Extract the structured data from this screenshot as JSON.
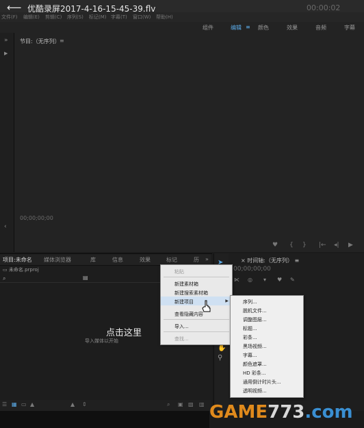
{
  "player": {
    "title": "优酷录屏2017-4-16-15-45-39.flv",
    "time": "00:00:02"
  },
  "menubar": [
    "文件(F)",
    "编辑(E)",
    "剪辑(C)",
    "序列(S)",
    "标记(M)",
    "字幕(T)",
    "窗口(W)",
    "帮助(H)"
  ],
  "workspace": {
    "tabs": [
      "组件",
      "编辑",
      "颜色",
      "效果",
      "音频",
      "字幕"
    ],
    "active_index": 1,
    "menu_glyph": "≡"
  },
  "program": {
    "title": "节目:（无序列）",
    "menu_glyph": "≡",
    "timecode": "00;00;00;00"
  },
  "project": {
    "tabs": [
      "项目:未命名",
      "媒体浏览器",
      "库",
      "信息",
      "效果",
      "标记",
      "历",
      "»"
    ],
    "file": "未命名.prproj",
    "empty_title": "点击这里",
    "empty_hint": "导入媒体以开始"
  },
  "timeline": {
    "title": "时间轴:（无序列）",
    "menu_glyph": "≡",
    "timecode": "00;00;00;00"
  },
  "context_menu": {
    "items": [
      "粘贴",
      "新建素材箱",
      "新建搜索素材箱",
      "新建项目",
      "查看隐藏内容",
      "导入...",
      "查找..."
    ]
  },
  "submenu": {
    "items": [
      "序列...",
      "脱机文件...",
      "调整图层...",
      "标题...",
      "彩条...",
      "黑场视频...",
      "字幕...",
      "颜色遮罩...",
      "HD 彩条...",
      "通用倒计时片头...",
      "透明视频..."
    ]
  },
  "watermark": {
    "brand": "GAME",
    "number": "773",
    "suffix": ".com"
  },
  "colors": {
    "accent": "#5aa9e6",
    "menu_bg": "#e9e9e9",
    "panel_bg": "#1d1d1d"
  }
}
